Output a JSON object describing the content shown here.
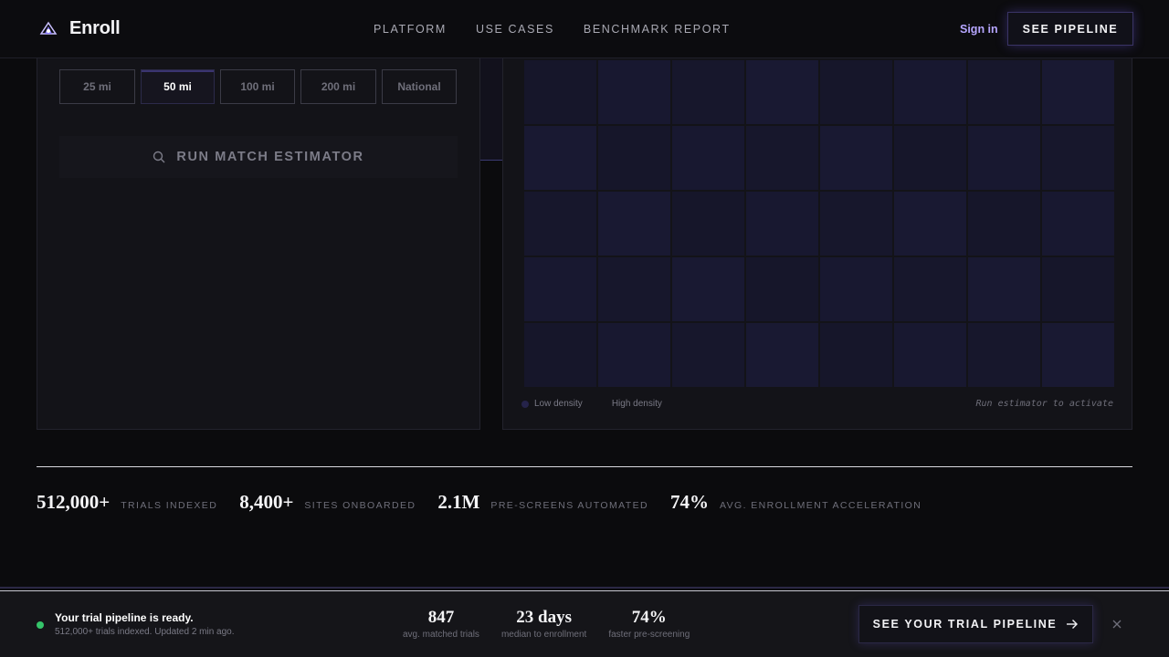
{
  "nav": {
    "brand": "Enroll",
    "links": [
      "PLATFORM",
      "USE CASES",
      "BENCHMARK REPORT"
    ],
    "sign_in": "Sign in",
    "cta": "SEE PIPELINE"
  },
  "estimator": {
    "radius_options": [
      "25 mi",
      "50 mi",
      "100 mi",
      "200 mi",
      "National"
    ],
    "selected_radius": "50 mi",
    "run_button": "RUN MATCH ESTIMATOR"
  },
  "map": {
    "legend_low": "Low density",
    "legend_high": "High density",
    "status": "Run estimator to activate"
  },
  "stats": [
    {
      "value": "512,000+",
      "label": "TRIALS INDEXED"
    },
    {
      "value": "8,400+",
      "label": "SITES ONBOARDED"
    },
    {
      "value": "2.1M",
      "label": "PRE-SCREENS AUTOMATED"
    },
    {
      "value": "74%",
      "label": "AVG. ENROLLMENT ACCELERATION"
    }
  ],
  "banner": {
    "title": "Your trial pipeline is ready.",
    "subtitle": "512,000+ trials indexed. Updated 2 min ago.",
    "stats": [
      {
        "value": "847",
        "label": "avg. matched trials"
      },
      {
        "value": "23 days",
        "label": "median to enrollment"
      },
      {
        "value": "74%",
        "label": "faster pre-screening"
      }
    ],
    "cta": "SEE YOUR TRIAL PIPELINE"
  },
  "colors": {
    "accent": "#b6a6ff",
    "ready_dot": "#35c46a",
    "background": "#0b0b0d"
  }
}
